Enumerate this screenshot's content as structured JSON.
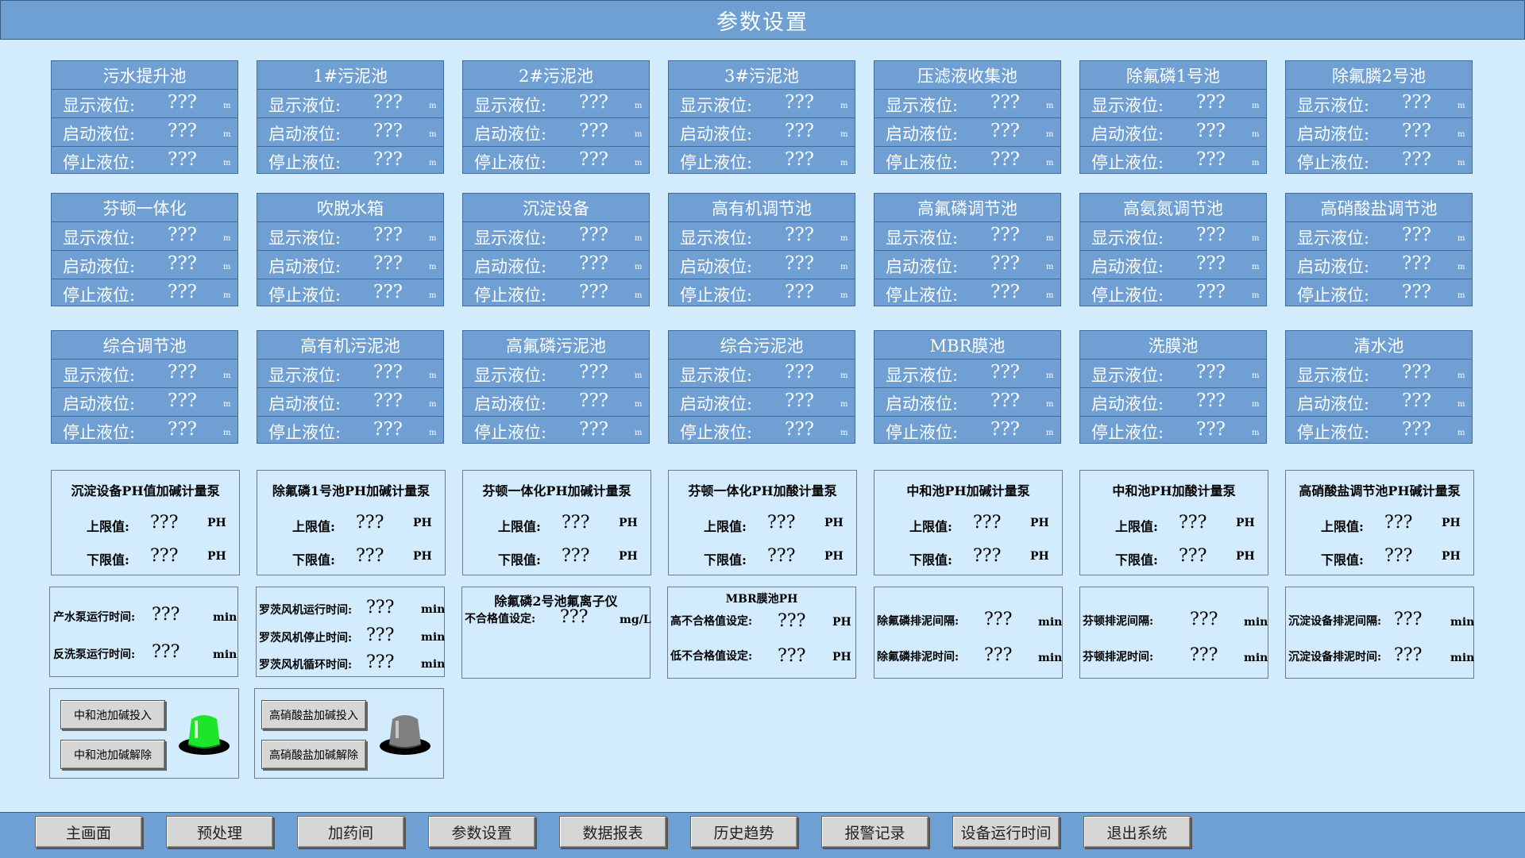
{
  "title": "参数设置",
  "tanks": [
    {
      "name": "污水提升池"
    },
    {
      "name": "1#污泥池"
    },
    {
      "name": "2#污泥池"
    },
    {
      "name": "3#污泥池"
    },
    {
      "name": "压滤液收集池"
    },
    {
      "name": "除氟磷1号池"
    },
    {
      "name": "除氟膦2号池"
    },
    {
      "name": "芬顿一体化"
    },
    {
      "name": "吹脱水箱"
    },
    {
      "name": "沉淀设备"
    },
    {
      "name": "高有机调节池"
    },
    {
      "name": "高氟磷调节池"
    },
    {
      "name": "高氨氮调节池"
    },
    {
      "name": "高硝酸盐调节池"
    },
    {
      "name": "综合调节池"
    },
    {
      "name": "高有机污泥池"
    },
    {
      "name": "高氟磷污泥池"
    },
    {
      "name": "综合污泥池"
    },
    {
      "name": "MBR膜池"
    },
    {
      "name": "洗膜池"
    },
    {
      "name": "清水池"
    }
  ],
  "level_labels": {
    "display": "显示液位:",
    "start": "启动液位:",
    "stop": "停止液位:"
  },
  "placeholder": "???",
  "unit_m": "m",
  "ph_pumps": [
    {
      "name": "沉淀设备PH值加碱计量泵"
    },
    {
      "name": "除氟磷1号池PH加碱计量泵"
    },
    {
      "name": "芬顿一体化PH加碱计量泵"
    },
    {
      "name": "芬顿一体化PH加酸计量泵"
    },
    {
      "name": "中和池PH加碱计量泵"
    },
    {
      "name": "中和池PH加酸计量泵"
    },
    {
      "name": "高硝酸盐调节池PH碱计量泵"
    }
  ],
  "ph_labels": {
    "upper": "上限值:",
    "lower": "下限值:",
    "unit": "PH"
  },
  "misc": {
    "produce_pump": "产水泵运行时间:",
    "backwash_pump": "反洗泵运行时间:",
    "roots_run": "罗茨风机运行时间:",
    "roots_stop": "罗茨风机停止时间:",
    "roots_cycle": "罗茨风机循环时间:",
    "fluoride_title": "除氟磷2号池氟离子仪",
    "fluoride_label": "不合格值设定:",
    "fluoride_unit": "mg/L",
    "mbr_title": "MBR膜池PH",
    "mbr_high": "高不合格值设定:",
    "mbr_low": "低不合格值设定:",
    "fp_interval": "除氟磷排泥间隔:",
    "fp_time": "除氟磷排泥时间:",
    "fenton_interval": "芬顿排泥间隔:",
    "fenton_time": "芬顿排泥时间:",
    "sed_interval": "沉淀设备排泥间隔:",
    "sed_time": "沉淀设备排泥时间:",
    "unit_min": "min"
  },
  "controls": {
    "neutral_on": "中和池加碱投入",
    "neutral_off": "中和池加碱解除",
    "nitrate_on": "高硝酸盐加碱投入",
    "nitrate_off": "高硝酸盐加碱解除",
    "neutral_lamp_color": "#22e02a",
    "nitrate_lamp_color": "#808080"
  },
  "nav": [
    "主画面",
    "预处理",
    "加药间",
    "参数设置",
    "数据报表",
    "历史趋势",
    "报警记录",
    "设备运行时间",
    "退出系统"
  ]
}
